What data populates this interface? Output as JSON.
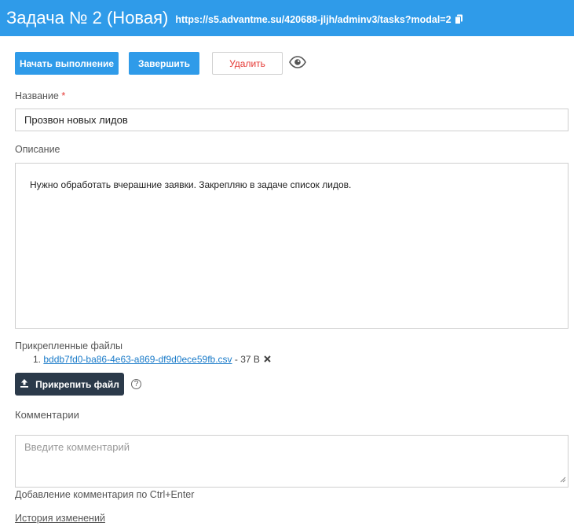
{
  "header": {
    "title": "Задача № 2 (Новая)",
    "url": "https://s5.advantme.su/420688-jljh/adminv3/tasks?modal=2"
  },
  "actions": {
    "start_label": "Начать выполнение",
    "finish_label": "Завершить",
    "delete_label": "Удалить"
  },
  "form": {
    "name_label": "Название",
    "name_required_mark": "*",
    "name_value": "Прозвон новых лидов",
    "description_label": "Описание",
    "description_value": "Нужно обработать вчерашние заявки. Закрепляю в задаче список лидов."
  },
  "files": {
    "label": "Прикрепленные файлы",
    "items": [
      {
        "index": "1.",
        "name": "bddb7fd0-ba86-4e63-a869-df9d0ece59fb.csv",
        "size": "- 37 B"
      }
    ],
    "attach_label": "Прикрепить файл",
    "help_glyph": "?"
  },
  "comments": {
    "label": "Комментарии",
    "placeholder": "Введите комментарий",
    "hint": "Добавление комментария по Ctrl+Enter",
    "history_link": "История изменений"
  },
  "colors": {
    "accent": "#2f9be9",
    "danger": "#e53935",
    "dark_button": "#2b3a4a",
    "link": "#1a7bc9"
  }
}
